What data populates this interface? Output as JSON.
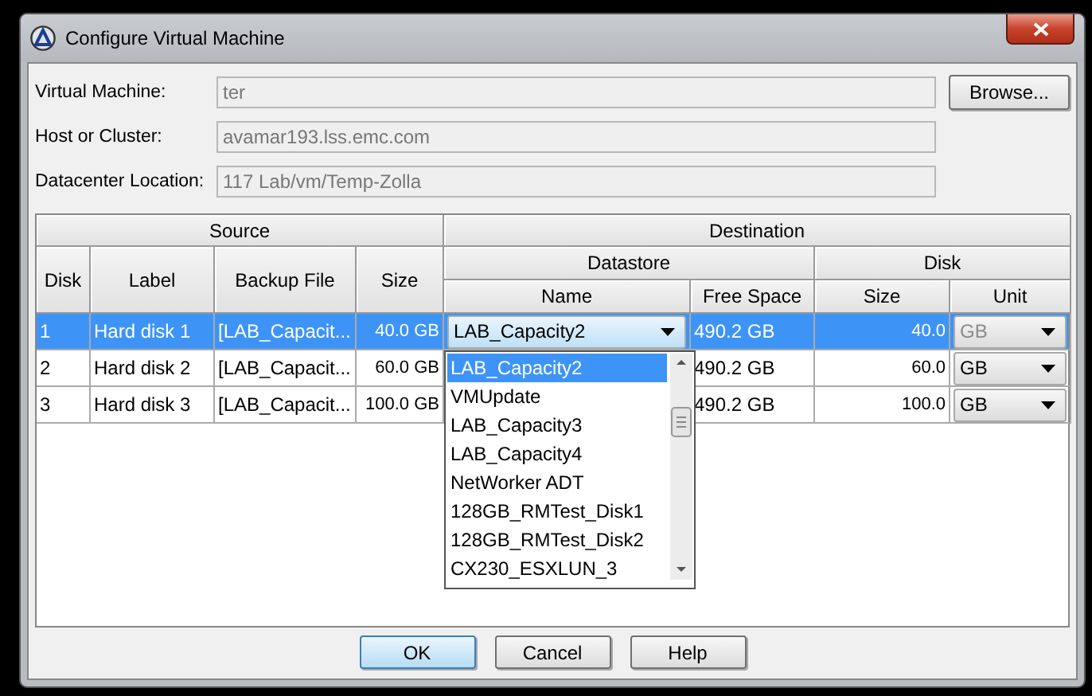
{
  "window": {
    "title": "Configure Virtual Machine"
  },
  "fields": [
    {
      "label": "Virtual Machine:",
      "value": "ter",
      "button": "Browse..."
    },
    {
      "label": "Host or Cluster:",
      "value": "avamar193.lss.emc.com"
    },
    {
      "label": "Datacenter Location:",
      "value": "117 Lab/vm/Temp-Zolla"
    }
  ],
  "table": {
    "groups": [
      "Source",
      "Destination"
    ],
    "subgroups": [
      "Datastore",
      "Disk"
    ],
    "columns": [
      "Disk",
      "Label",
      "Backup File",
      "Size",
      "Name",
      "Free Space",
      "Size",
      "Unit"
    ],
    "rows": [
      {
        "selected": true,
        "disk": "1",
        "label": "Hard disk 1",
        "backup_file": "[LAB_Capacit...",
        "size": "40.0 GB",
        "name": "LAB_Capacity2",
        "free_space": "490.2 GB",
        "disk_size": "40.0",
        "unit": "GB"
      },
      {
        "selected": false,
        "disk": "2",
        "label": "Hard disk 2",
        "backup_file": "[LAB_Capacit...",
        "size": "60.0 GB",
        "free_space": "490.2 GB",
        "disk_size": "60.0",
        "unit": "GB"
      },
      {
        "selected": false,
        "disk": "3",
        "label": "Hard disk 3",
        "backup_file": "[LAB_Capacit...",
        "size": "100.0 GB",
        "free_space": "490.2 GB",
        "disk_size": "100.0",
        "unit": "GB"
      }
    ],
    "dropdown": {
      "items": [
        {
          "label": "LAB_Capacity2",
          "selected": true
        },
        {
          "label": "VMUpdate",
          "selected": false
        },
        {
          "label": "LAB_Capacity3",
          "selected": false
        },
        {
          "label": "LAB_Capacity4",
          "selected": false
        },
        {
          "label": "NetWorker ADT",
          "selected": false
        },
        {
          "label": "128GB_RMTest_Disk1",
          "selected": false
        },
        {
          "label": "128GB_RMTest_Disk2",
          "selected": false
        },
        {
          "label": "CX230_ESXLUN_3",
          "selected": false
        }
      ]
    }
  },
  "buttons": [
    {
      "label": "OK",
      "default": true
    },
    {
      "label": "Cancel",
      "default": false
    },
    {
      "label": "Help",
      "default": false
    }
  ]
}
